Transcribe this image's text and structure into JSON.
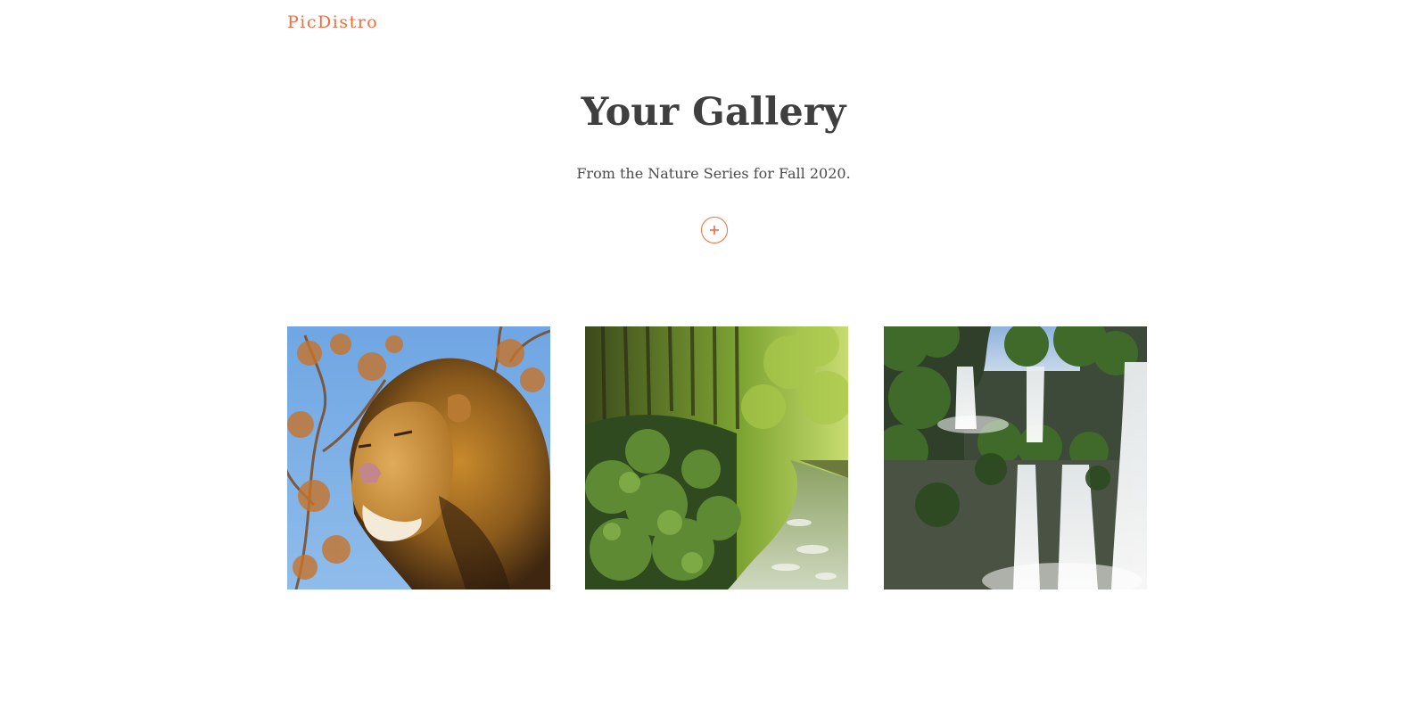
{
  "header": {
    "brand": "PicDistro"
  },
  "hero": {
    "title": "Your Gallery",
    "subtitle": "From the Nature Series for Fall 2020.",
    "add_icon": "plus-icon"
  },
  "gallery": {
    "photos": [
      {
        "subject": "lion"
      },
      {
        "subject": "forest-stream"
      },
      {
        "subject": "waterfall"
      }
    ]
  },
  "colors": {
    "accent": "#f36b3b",
    "heading": "#3f3f3f",
    "text": "#4a4a4a"
  }
}
